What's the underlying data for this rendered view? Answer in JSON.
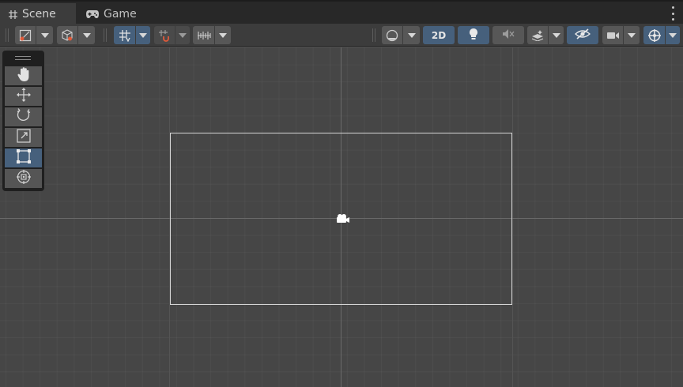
{
  "tabs": {
    "scene": {
      "label": "Scene",
      "icon": "grid-hash-icon"
    },
    "game": {
      "label": "Game",
      "icon": "gamepad-icon"
    }
  },
  "toolbar": {
    "mode_2d_label": "2D",
    "accent_color": "#46607c"
  },
  "tools": [
    "hand-tool",
    "move-tool",
    "rotate-tool",
    "scale-tool",
    "rect-tool",
    "transform-tool"
  ],
  "selected_tool": "rect-tool"
}
